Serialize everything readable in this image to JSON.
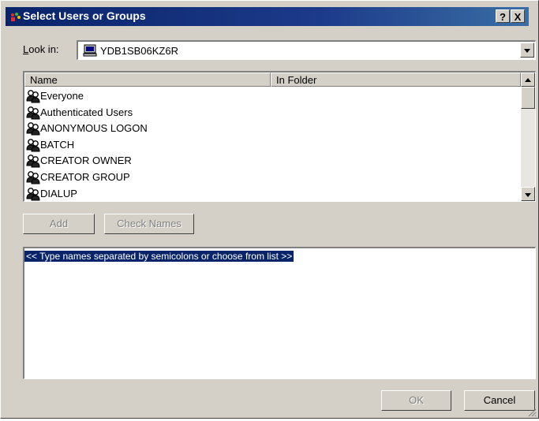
{
  "window": {
    "title": "Select Users or Groups",
    "help_button": "?",
    "close_button": "X"
  },
  "look_in": {
    "label_prefix": "L",
    "label_rest": "ook in:",
    "value": "YDB1SB06KZ6R"
  },
  "list": {
    "columns": [
      "Name",
      "In Folder"
    ],
    "items": [
      {
        "name": "Everyone",
        "folder": ""
      },
      {
        "name": "Authenticated Users",
        "folder": ""
      },
      {
        "name": "ANONYMOUS LOGON",
        "folder": ""
      },
      {
        "name": "BATCH",
        "folder": ""
      },
      {
        "name": "CREATOR OWNER",
        "folder": ""
      },
      {
        "name": "CREATOR GROUP",
        "folder": ""
      },
      {
        "name": "DIALUP",
        "folder": ""
      }
    ]
  },
  "buttons": {
    "add_label": "Add",
    "check_names_label": "Check Names",
    "ok_label": "OK",
    "cancel_label": "Cancel"
  },
  "names_box": {
    "hint": "<< Type names separated by semicolons or choose from list >>"
  },
  "colors": {
    "title_bar": "#0a246a",
    "dialog_face": "#d4d0c8",
    "selection": "#0a246a"
  },
  "icons": {
    "title": "users-groups-icon",
    "computer": "computer-icon",
    "group": "group-icon"
  }
}
